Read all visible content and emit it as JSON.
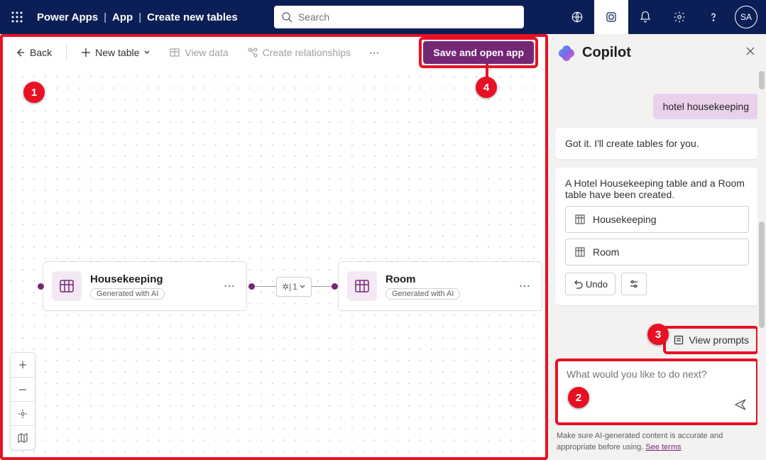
{
  "header": {
    "app": "Power Apps",
    "crumbs": [
      "App",
      "Create new tables"
    ],
    "search_placeholder": "Search",
    "avatar": "SA"
  },
  "toolbar": {
    "back": "Back",
    "new_table": "New table",
    "view_data": "View data",
    "create_rel": "Create relationships",
    "save_open": "Save and open app"
  },
  "tables": [
    {
      "name": "Housekeeping",
      "badge": "Generated with AI"
    },
    {
      "name": "Room",
      "badge": "Generated with AI"
    }
  ],
  "relation": {
    "label": "1"
  },
  "copilot": {
    "title": "Copilot",
    "user_msg": "hotel housekeeping",
    "bot_msg1": "Got it. I'll create tables for you.",
    "bot_msg2": "A Hotel Housekeeping table and a Room table have been created.",
    "link_housekeeping": "Housekeeping",
    "link_room": "Room",
    "undo": "Undo",
    "view_prompts": "View prompts",
    "input_placeholder": "What would you like to do next?",
    "disclaimer_pre": "Make sure AI-generated content is accurate and appropriate before using. ",
    "disclaimer_link": "See terms"
  },
  "callouts": {
    "c1": "1",
    "c2": "2",
    "c3": "3",
    "c4": "4"
  }
}
